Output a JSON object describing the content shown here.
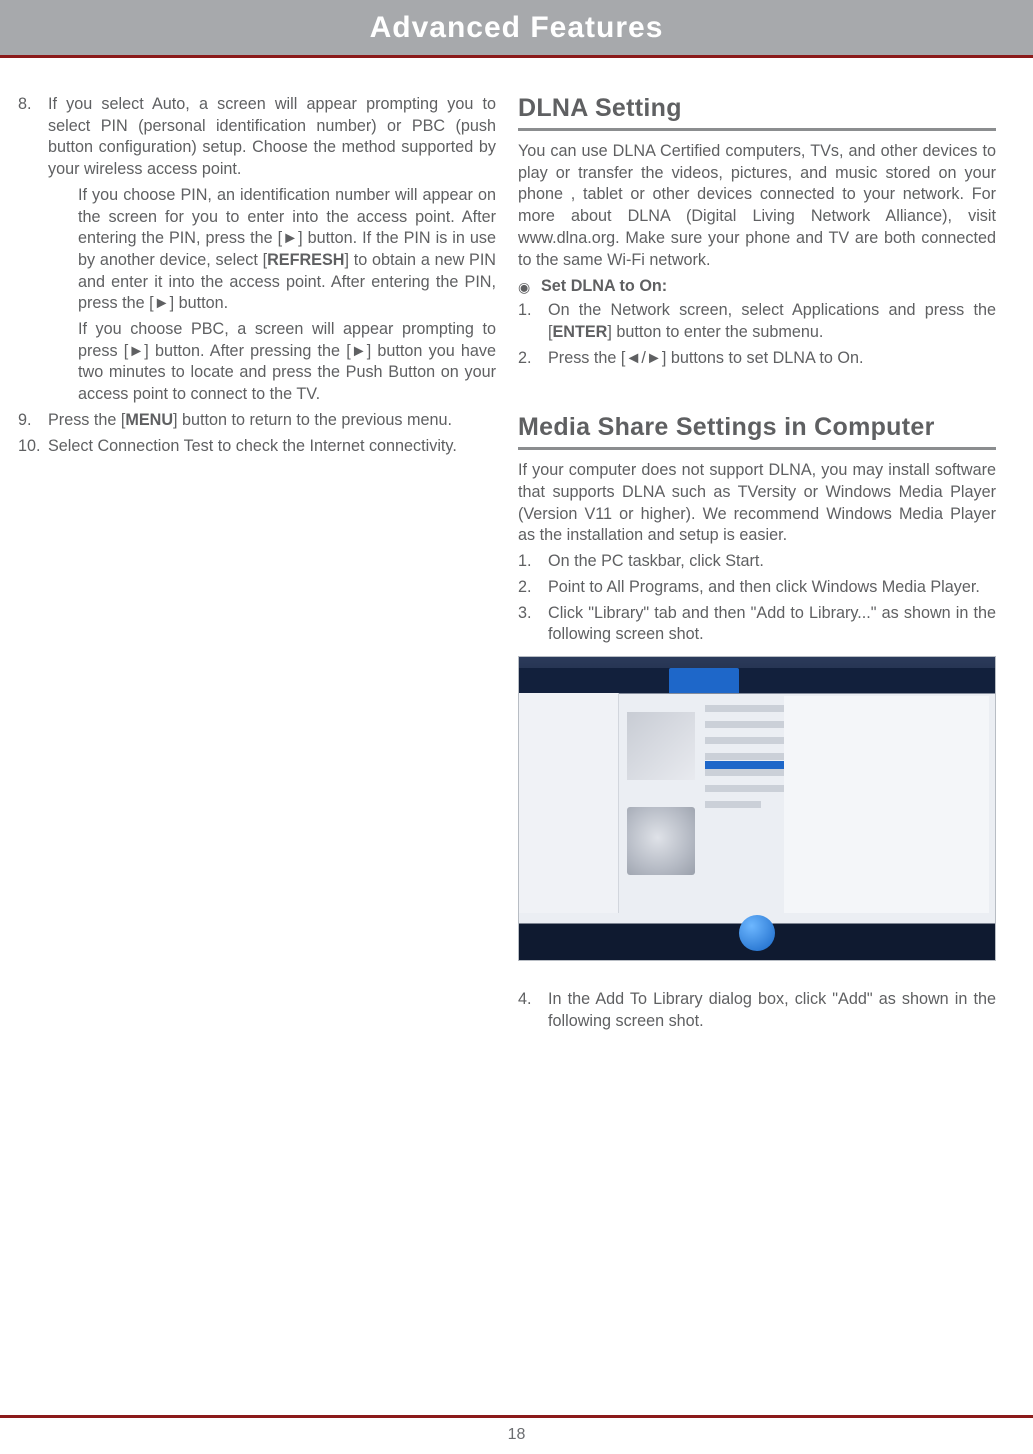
{
  "header": {
    "title": "Advanced Features"
  },
  "left": {
    "items": [
      {
        "num": "8.",
        "text": "If you select Auto, a screen will appear prompting you to select PIN (personal identification number) or PBC (push button configuration) setup. Choose the method supported by your wireless access point."
      },
      {
        "sub": "If you choose PIN, an identification number will appear on the screen for you to enter into the access point. After entering the PIN, press the [►] button. If the PIN is in use by another device, select [REFRESH] to obtain a new PIN and enter it into the access point. After entering the PIN, press the [►] button."
      },
      {
        "sub": "If you choose PBC, a screen will appear prompting to press [►] button. After pressing the [►] button you have two minutes to locate and press the Push Button on your access point to connect to the TV."
      },
      {
        "num": "9.",
        "text": "Press the [MENU] button to return to the previous menu."
      },
      {
        "num": "10.",
        "text": "Select Connection Test to check the Internet connectivity."
      }
    ]
  },
  "right": {
    "dlna_heading": "DLNA Setting",
    "dlna_intro": "You can use DLNA Certified computers, TVs, and other devices to play or transfer the videos, pictures, and music stored on your phone , tablet or other devices connected to your network. For more about DLNA (Digital Living Network Alliance), visit www.dlna.org. Make sure your phone and TV are both connected to the same Wi-Fi network.",
    "set_dlna_label": "Set DLNA to On:",
    "dlna_steps": [
      {
        "num": "1.",
        "text": "On the Network screen, select Applications and press the [ENTER] button to enter the submenu."
      },
      {
        "num": "2.",
        "text": "Press the [◄/►] buttons to set DLNA to On."
      }
    ],
    "media_heading": "Media Share Settings in Computer",
    "media_intro": "If your computer does not support DLNA, you may install software that supports DLNA such as TVersity or Windows Media Player (Version V11 or higher). We recommend Windows Media Player as the installation and setup is easier.",
    "media_steps_a": [
      {
        "num": "1.",
        "text": "On the PC taskbar, click Start."
      },
      {
        "num": "2.",
        "text": "Point to All Programs, and then click Windows Media Player."
      },
      {
        "num": "3.",
        "text": "Click \"Library\" tab and then \"Add to Library...\" as shown in the following screen shot."
      }
    ],
    "media_steps_b": [
      {
        "num": "4.",
        "text": "In the Add To Library dialog box, click \"Add\" as shown in the following screen shot."
      }
    ]
  },
  "page_number": "18"
}
